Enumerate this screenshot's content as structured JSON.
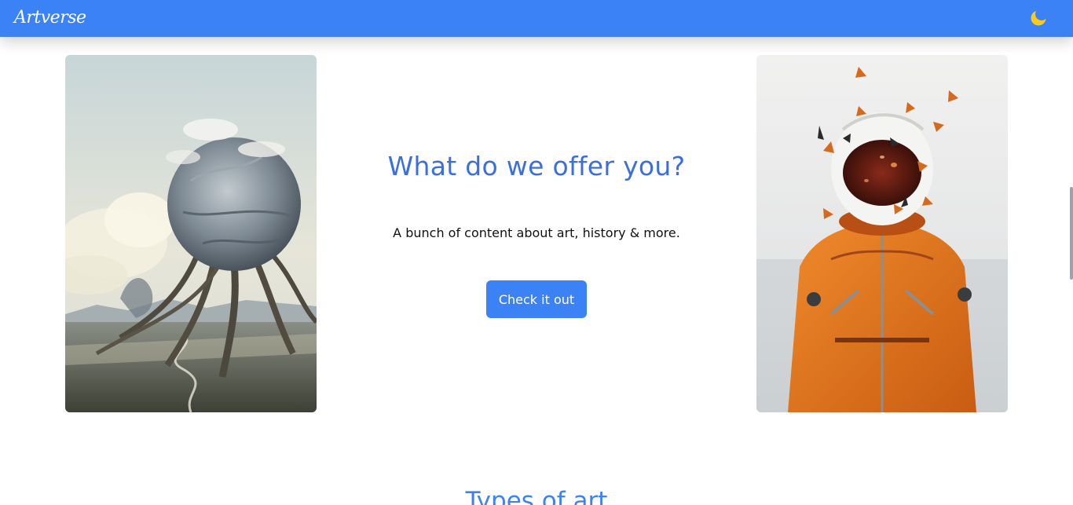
{
  "navbar": {
    "logo_text": "Artverse",
    "theme_toggle_icon": "moon-icon",
    "background_color": "#3b82f6",
    "moon_color": "#facc15"
  },
  "hero": {
    "title": "What do we offer you?",
    "description": "A bunch of content about art, history & more.",
    "button_label": "Check it out",
    "left_image": "surreal-landscape-artwork",
    "right_image": "astronaut-with-butterflies-artwork"
  },
  "next_section": {
    "title": "Types of art"
  },
  "colors": {
    "accent": "#3b82f6",
    "heading": "#3b6fe0",
    "text": "#111111"
  }
}
